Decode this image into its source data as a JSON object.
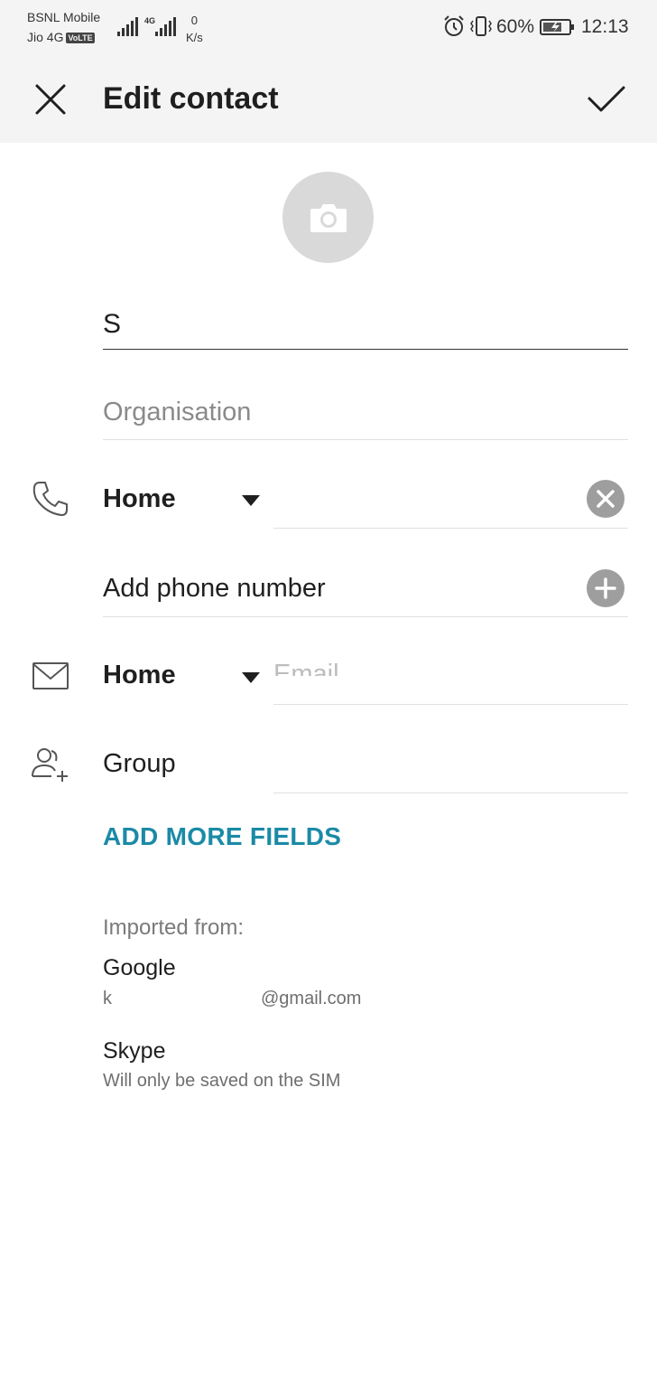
{
  "status_bar": {
    "carrier1": "BSNL Mobile",
    "carrier2": "Jio 4G",
    "volte_badge": "VoLTE",
    "network_type": "4G",
    "speed_value": "0",
    "speed_unit": "K/s",
    "battery_percent": "60%",
    "time": "12:13",
    "icons": [
      "signal-icon",
      "alarm-icon",
      "vibrate-icon",
      "battery-charging-icon"
    ]
  },
  "app_bar": {
    "title": "Edit contact",
    "close_icon": "close-icon",
    "save_icon": "check-icon"
  },
  "avatar": {
    "icon": "camera-icon"
  },
  "form": {
    "name_value": "S",
    "organisation_placeholder": "Organisation",
    "phone": {
      "type": "Home",
      "value": "",
      "icon": "phone-icon"
    },
    "add_phone_label": "Add phone number",
    "email": {
      "type": "Home",
      "placeholder": "Email",
      "icon": "mail-icon"
    },
    "group_label": "Group",
    "group_icon": "add-person-icon",
    "add_more_fields": "ADD MORE FIELDS"
  },
  "imported": {
    "heading": "Imported from:",
    "accounts": [
      {
        "name": "Google",
        "detail_start": "k",
        "detail_end": "@gmail.com"
      },
      {
        "name": "Skype",
        "detail": "Will only be saved on the SIM"
      }
    ]
  },
  "colors": {
    "accent": "#1a8aa6",
    "bar_background": "#f4f4f4",
    "avatar_background": "#d9d9d9",
    "circle_button": "#9e9e9e"
  }
}
